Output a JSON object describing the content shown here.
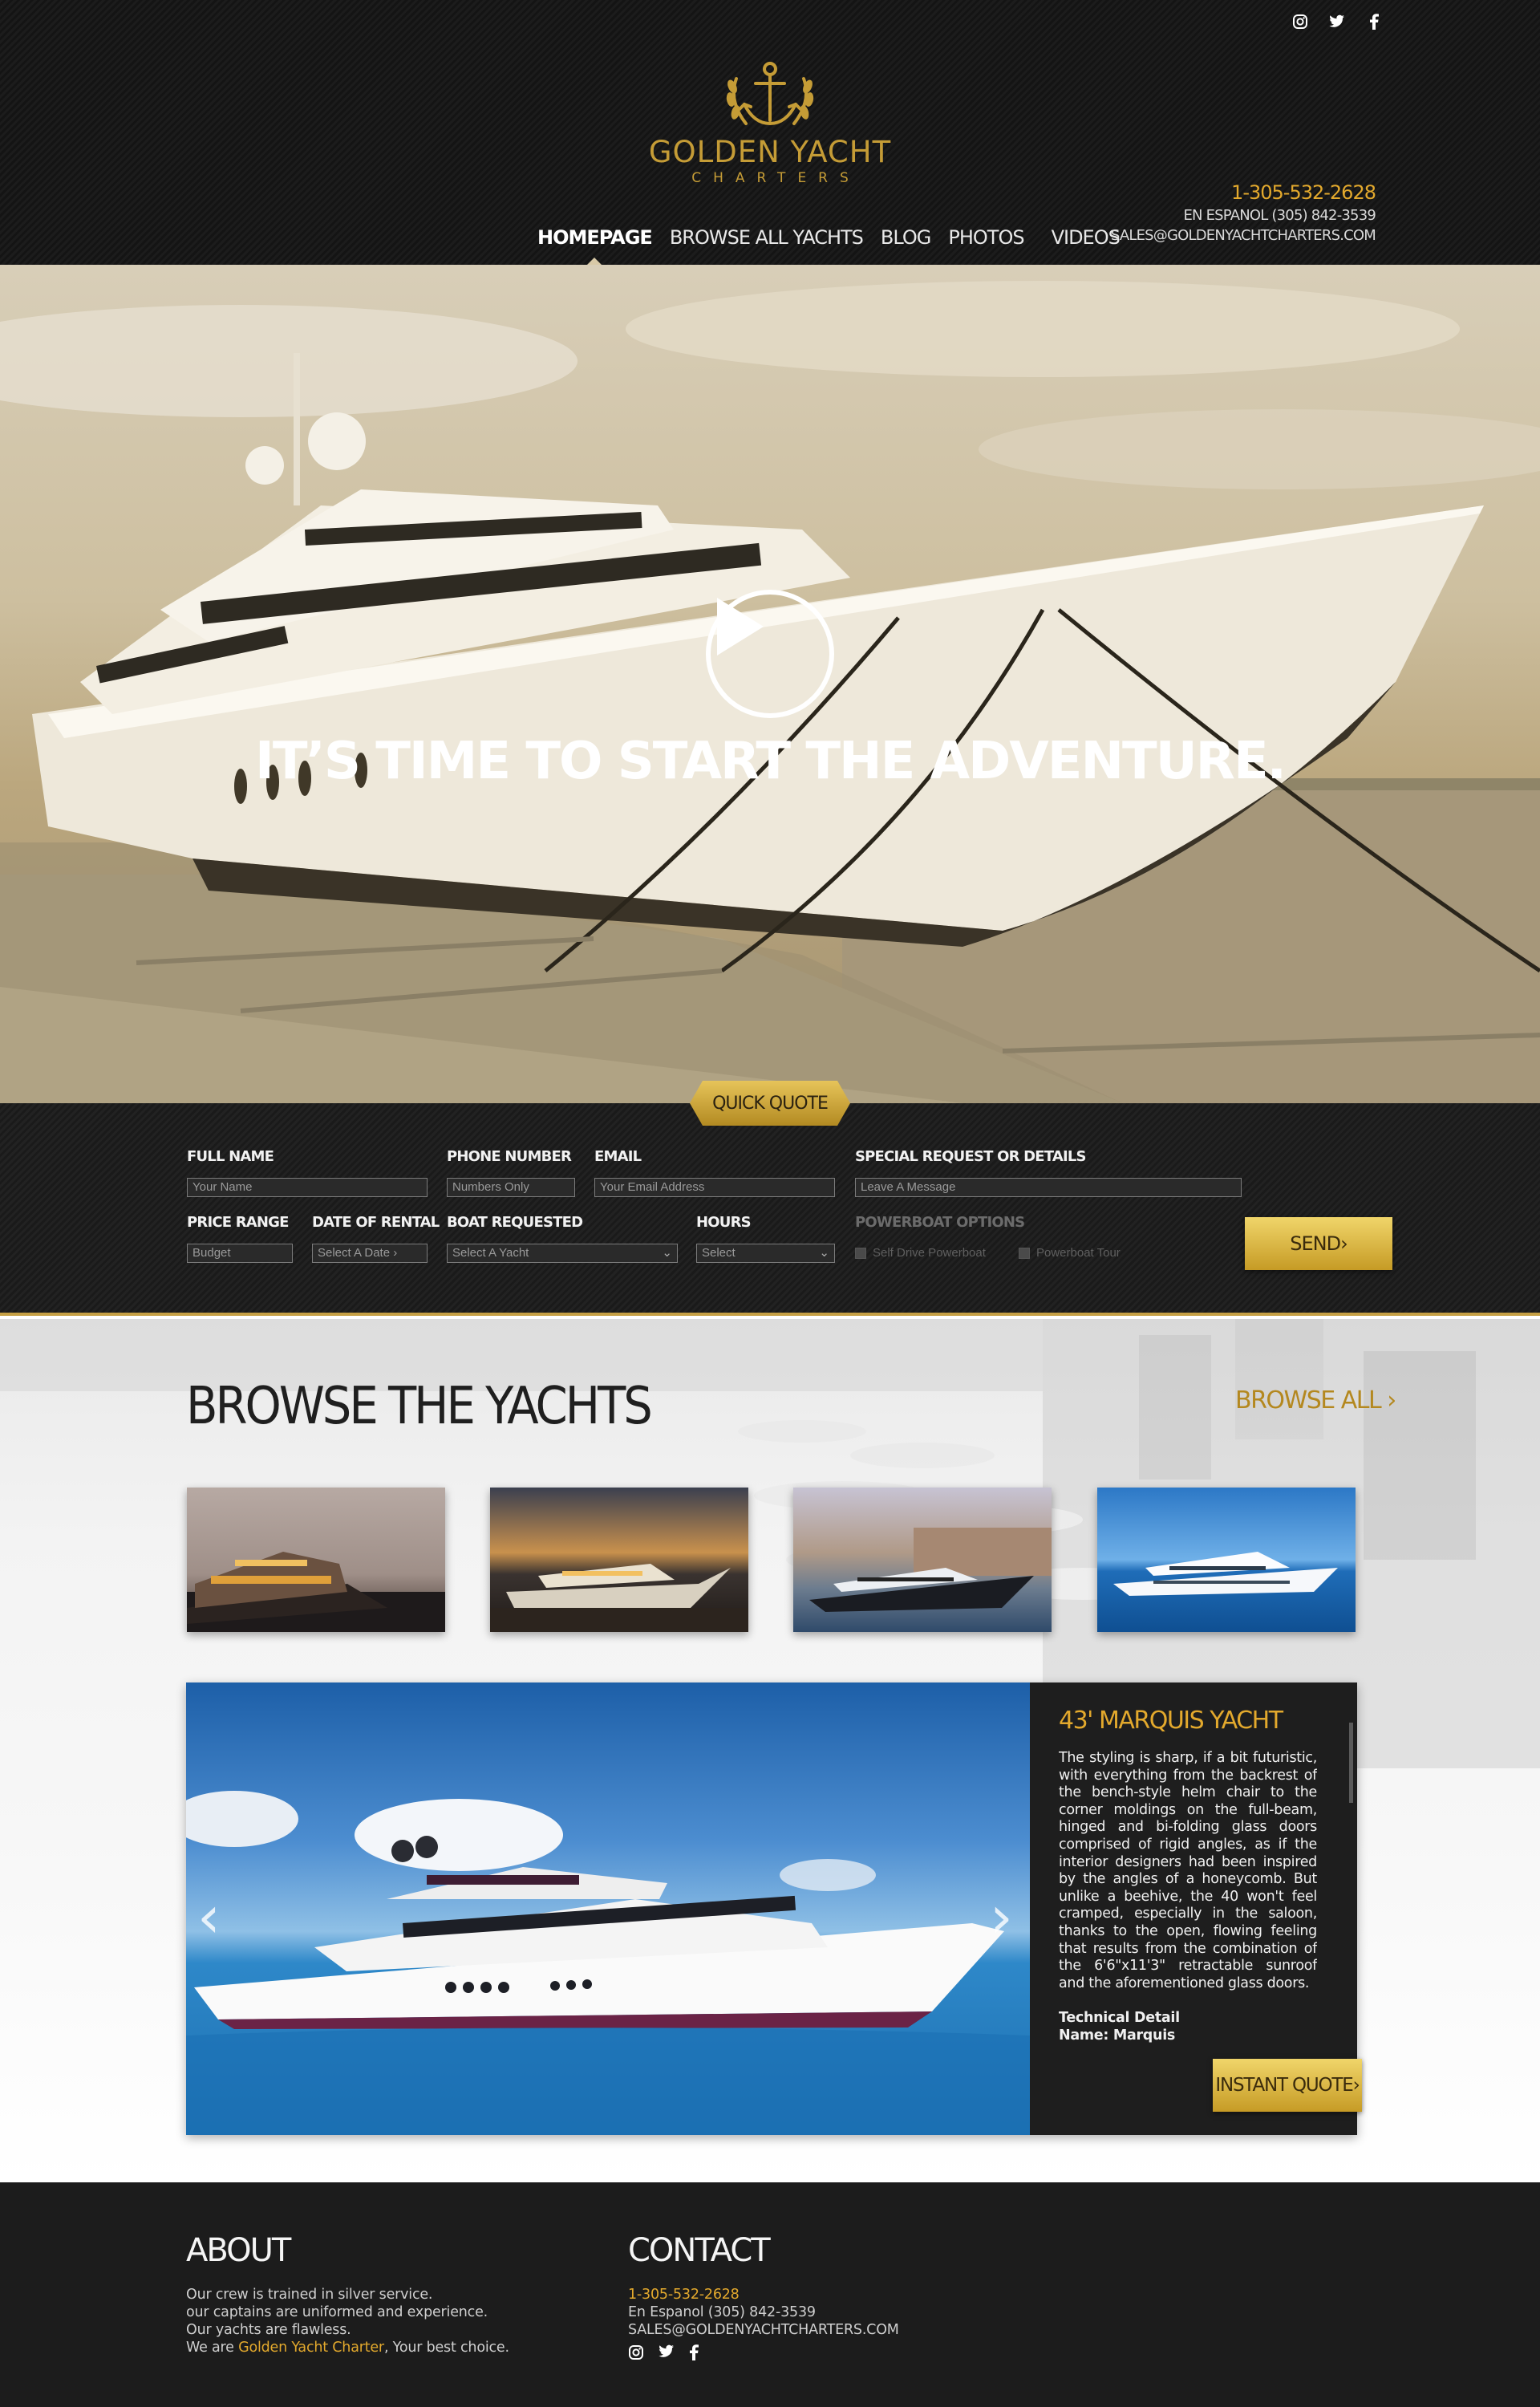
{
  "brand": {
    "name_line1": "GOLDEN YACHT",
    "name_line2": "CHARTERS",
    "gold": "#c59c36",
    "accent": "#e3a92d"
  },
  "header": {
    "social_icons": [
      "instagram-icon",
      "twitter-icon",
      "facebook-icon"
    ],
    "nav": [
      "HOMEPAGE",
      "BROWSE ALL YACHTS",
      "BLOG",
      "PHOTOS",
      "VIDEOS"
    ],
    "nav_active": "HOMEPAGE",
    "phone": "1-305-532-2628",
    "espanol": "EN ESPANOL (305) 842-3539",
    "email": "SALES@GOLDENYACHTCHARTERS.COM"
  },
  "hero": {
    "title": "IT’S TIME TO START THE ADVENTURE.",
    "play_icon": "play-icon"
  },
  "quote_form": {
    "tab_label": "QUICK QUOTE",
    "full_name": {
      "label": "FULL NAME",
      "placeholder": "Your Name"
    },
    "phone": {
      "label": "PHONE NUMBER",
      "placeholder": "Numbers Only"
    },
    "email": {
      "label": "EMAIL",
      "placeholder": "Your Email Address"
    },
    "special": {
      "label": "SPECIAL REQUEST OR DETAILS",
      "placeholder": "Leave A Message"
    },
    "price": {
      "label": "PRICE RANGE",
      "placeholder": "Budget"
    },
    "date": {
      "label": "DATE OF RENTAL",
      "placeholder": "Select A Date ›"
    },
    "boat": {
      "label": "BOAT REQUESTED",
      "value": "Select A Yacht"
    },
    "hours": {
      "label": "HOURS",
      "value": "Select"
    },
    "powerboat": {
      "label": "POWERBOAT OPTIONS",
      "options": [
        "Self Drive Powerboat",
        "Powerboat Tour"
      ]
    },
    "send_label": "SEND›"
  },
  "browse": {
    "title": "BROWSE THE YACHTS",
    "browse_all": "BROWSE ALL ›",
    "featured": {
      "title": "43' MARQUIS YACHT",
      "description": "The styling is sharp, if a bit futuristic, with everything from the backrest of the bench-style helm chair to the corner moldings on the full-beam, hinged and bi-folding glass doors comprised of rigid angles, as if the interior designers had been inspired by the angles of a honeycomb. But unlike a beehive, the 40 won't feel cramped, especially in the saloon, thanks to the open, flowing feeling that results from the combination of the 6'6\"x11'3\" retractable sunroof and the aforementioned glass doors.",
      "tech_heading": "Technical Detail",
      "tech_line": "Name: Marquis",
      "prev": "‹",
      "next": "›",
      "quote_button": "INSTANT QUOTE›"
    }
  },
  "footer": {
    "about": {
      "heading": "ABOUT",
      "lines": [
        "Our crew is trained in silver service.",
        "our captains are uniformed and experience.",
        "Our yachts are flawless."
      ],
      "last_prefix": "We are ",
      "last_brand": "Golden Yacht Charter",
      "last_suffix": ", Your best choice."
    },
    "contact": {
      "heading": "CONTACT",
      "phone": "1-305-532-2628",
      "espanol": "En Espanol (305) 842-3539",
      "email": "SALES@GOLDENYACHTCHARTERS.COM",
      "social_icons": [
        "instagram-icon",
        "twitter-icon",
        "facebook-icon"
      ]
    }
  }
}
